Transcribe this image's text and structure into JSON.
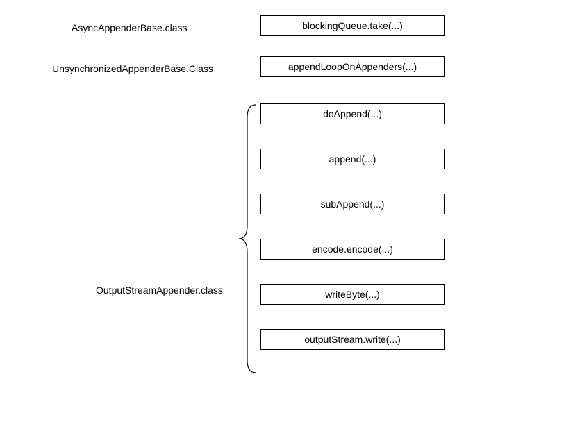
{
  "rows": [
    {
      "label": "AsyncAppenderBase.class",
      "method": "blockingQueue.take(...)"
    },
    {
      "label": "UnsynchronizedAppenderBase.Class",
      "method": "appendLoopOnAppenders(...)"
    }
  ],
  "group": {
    "label": "OutputStreamAppender.class",
    "methods": [
      "doAppend(...)",
      "append(...)",
      "subAppend(...)",
      "encode.encode(...)",
      "writeByte(...)",
      "outputStream.write(...)"
    ]
  }
}
